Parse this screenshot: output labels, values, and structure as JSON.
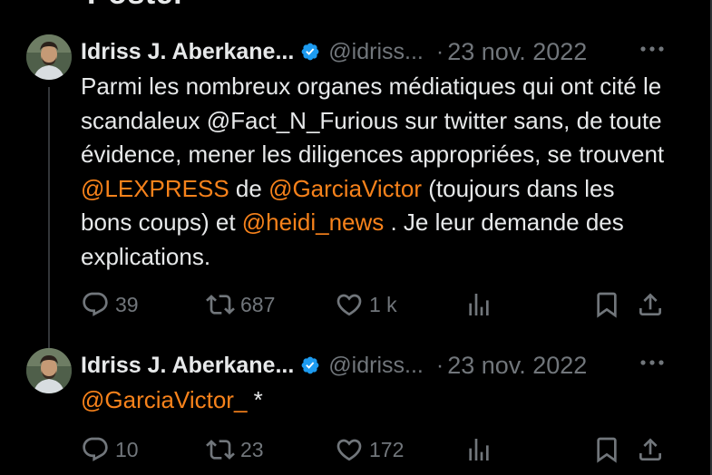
{
  "page": {
    "cut_title": "Poster"
  },
  "tweets": [
    {
      "author_name": "Idriss J. Aberkane...",
      "handle": "@idriss...",
      "separator": "·",
      "date": "23 nov. 2022",
      "text": {
        "p1": "Parmi les nombreux organes médiatiques qui ont cité le scandaleux @Fact_N_Furious sur twitter sans, de toute évidence, mener les diligences appropriées, se trouvent ",
        "m1": "@LEXPRESS",
        "p2": " de ",
        "m2": "@GarciaVictor",
        "p3": " (toujours dans les bons coups) et ",
        "m3": "@heidi_news",
        "p4": " . Je leur demande des explications."
      },
      "replies": "39",
      "retweets": "687",
      "likes": "1 k"
    },
    {
      "author_name": "Idriss J. Aberkane...",
      "handle": "@idriss...",
      "separator": "·",
      "date": "23 nov. 2022",
      "text": {
        "m1": "@GarciaVictor_",
        "p1": " *"
      },
      "replies": "10",
      "retweets": "23",
      "likes": "172"
    }
  ],
  "icons": {
    "verified": "verified-badge-icon",
    "more": "more-horizontal-icon",
    "reply": "reply-icon",
    "retweet": "retweet-icon",
    "like": "heart-icon",
    "views": "views-chart-icon",
    "bookmark": "bookmark-icon",
    "share": "share-icon"
  },
  "colors": {
    "background": "#000000",
    "text": "#e7e9ea",
    "secondary": "#71767b",
    "mention": "#f7821b",
    "verified": "#1d9bf0"
  }
}
